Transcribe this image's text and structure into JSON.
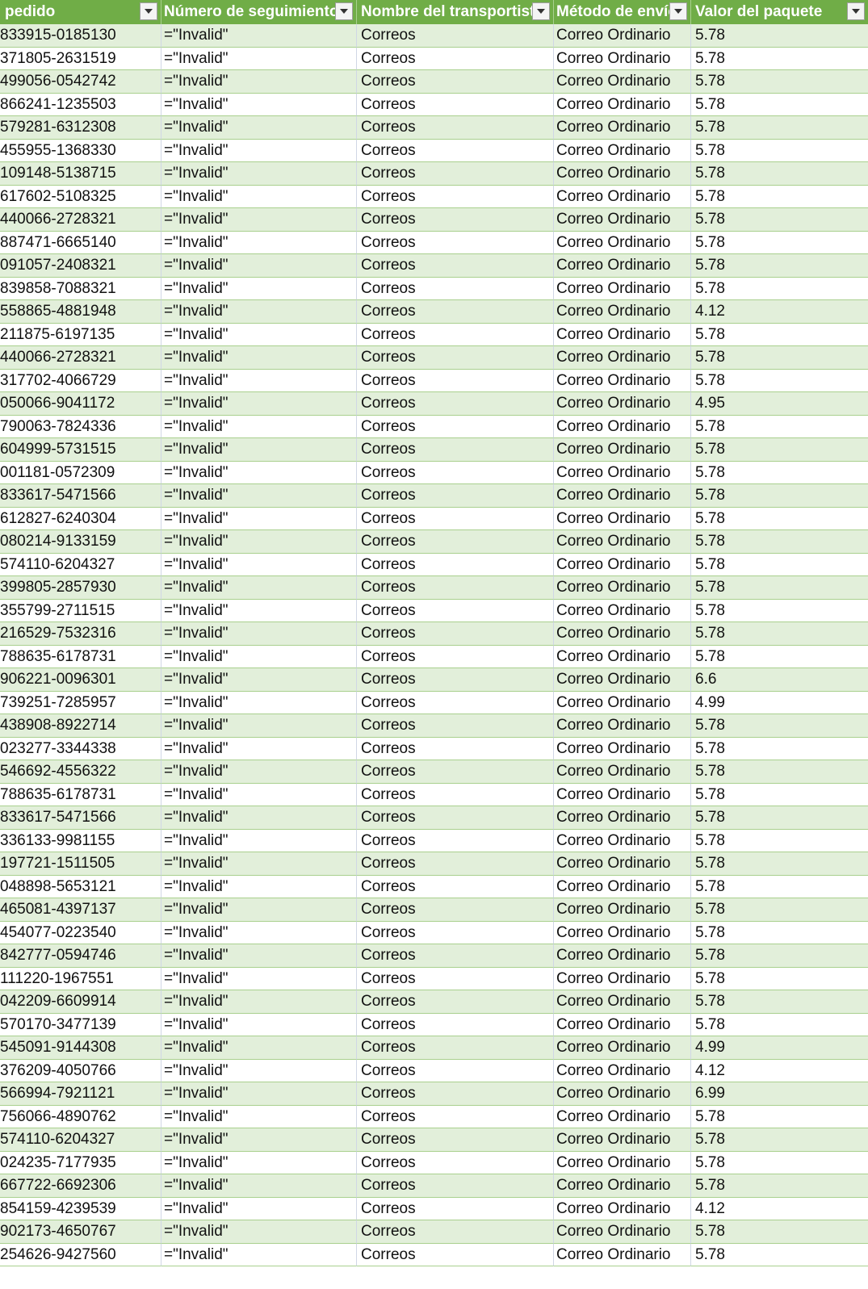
{
  "table": {
    "columns": [
      "pedido",
      "Número de seguimiento",
      "Nombre del transportista",
      "Método de envío",
      "Valor del paquete"
    ],
    "rows": [
      [
        "833915-0185130",
        "=\"Invalid\"",
        "Correos",
        "Correo Ordinario",
        "5.78"
      ],
      [
        "371805-2631519",
        "=\"Invalid\"",
        "Correos",
        "Correo Ordinario",
        "5.78"
      ],
      [
        "499056-0542742",
        "=\"Invalid\"",
        "Correos",
        "Correo Ordinario",
        "5.78"
      ],
      [
        "866241-1235503",
        "=\"Invalid\"",
        "Correos",
        "Correo Ordinario",
        "5.78"
      ],
      [
        "579281-6312308",
        "=\"Invalid\"",
        "Correos",
        "Correo Ordinario",
        "5.78"
      ],
      [
        "455955-1368330",
        "=\"Invalid\"",
        "Correos",
        "Correo Ordinario",
        "5.78"
      ],
      [
        "109148-5138715",
        "=\"Invalid\"",
        "Correos",
        "Correo Ordinario",
        "5.78"
      ],
      [
        "617602-5108325",
        "=\"Invalid\"",
        "Correos",
        "Correo Ordinario",
        "5.78"
      ],
      [
        "440066-2728321",
        "=\"Invalid\"",
        "Correos",
        "Correo Ordinario",
        "5.78"
      ],
      [
        "887471-6665140",
        "=\"Invalid\"",
        "Correos",
        "Correo Ordinario",
        "5.78"
      ],
      [
        "091057-2408321",
        "=\"Invalid\"",
        "Correos",
        "Correo Ordinario",
        "5.78"
      ],
      [
        "839858-7088321",
        "=\"Invalid\"",
        "Correos",
        "Correo Ordinario",
        "5.78"
      ],
      [
        "558865-4881948",
        "=\"Invalid\"",
        "Correos",
        "Correo Ordinario",
        "4.12"
      ],
      [
        "211875-6197135",
        "=\"Invalid\"",
        "Correos",
        "Correo Ordinario",
        "5.78"
      ],
      [
        "440066-2728321",
        "=\"Invalid\"",
        "Correos",
        "Correo Ordinario",
        "5.78"
      ],
      [
        "317702-4066729",
        "=\"Invalid\"",
        "Correos",
        "Correo Ordinario",
        "5.78"
      ],
      [
        "050066-9041172",
        "=\"Invalid\"",
        "Correos",
        "Correo Ordinario",
        "4.95"
      ],
      [
        "790063-7824336",
        "=\"Invalid\"",
        "Correos",
        "Correo Ordinario",
        "5.78"
      ],
      [
        "604999-5731515",
        "=\"Invalid\"",
        "Correos",
        "Correo Ordinario",
        "5.78"
      ],
      [
        "001181-0572309",
        "=\"Invalid\"",
        "Correos",
        "Correo Ordinario",
        "5.78"
      ],
      [
        "833617-5471566",
        "=\"Invalid\"",
        "Correos",
        "Correo Ordinario",
        "5.78"
      ],
      [
        "612827-6240304",
        "=\"Invalid\"",
        "Correos",
        "Correo Ordinario",
        "5.78"
      ],
      [
        "080214-9133159",
        "=\"Invalid\"",
        "Correos",
        "Correo Ordinario",
        "5.78"
      ],
      [
        "574110-6204327",
        "=\"Invalid\"",
        "Correos",
        "Correo Ordinario",
        "5.78"
      ],
      [
        "399805-2857930",
        "=\"Invalid\"",
        "Correos",
        "Correo Ordinario",
        "5.78"
      ],
      [
        "355799-2711515",
        "=\"Invalid\"",
        "Correos",
        "Correo Ordinario",
        "5.78"
      ],
      [
        "216529-7532316",
        "=\"Invalid\"",
        "Correos",
        "Correo Ordinario",
        "5.78"
      ],
      [
        "788635-6178731",
        "=\"Invalid\"",
        "Correos",
        "Correo Ordinario",
        "5.78"
      ],
      [
        "906221-0096301",
        "=\"Invalid\"",
        "Correos",
        "Correo Ordinario",
        "6.6"
      ],
      [
        "739251-7285957",
        "=\"Invalid\"",
        "Correos",
        "Correo Ordinario",
        "4.99"
      ],
      [
        "438908-8922714",
        "=\"Invalid\"",
        "Correos",
        "Correo Ordinario",
        "5.78"
      ],
      [
        "023277-3344338",
        "=\"Invalid\"",
        "Correos",
        "Correo Ordinario",
        "5.78"
      ],
      [
        "546692-4556322",
        "=\"Invalid\"",
        "Correos",
        "Correo Ordinario",
        "5.78"
      ],
      [
        "788635-6178731",
        "=\"Invalid\"",
        "Correos",
        "Correo Ordinario",
        "5.78"
      ],
      [
        "833617-5471566",
        "=\"Invalid\"",
        "Correos",
        "Correo Ordinario",
        "5.78"
      ],
      [
        "336133-9981155",
        "=\"Invalid\"",
        "Correos",
        "Correo Ordinario",
        "5.78"
      ],
      [
        "197721-1511505",
        "=\"Invalid\"",
        "Correos",
        "Correo Ordinario",
        "5.78"
      ],
      [
        "048898-5653121",
        "=\"Invalid\"",
        "Correos",
        "Correo Ordinario",
        "5.78"
      ],
      [
        "465081-4397137",
        "=\"Invalid\"",
        "Correos",
        "Correo Ordinario",
        "5.78"
      ],
      [
        "454077-0223540",
        "=\"Invalid\"",
        "Correos",
        "Correo Ordinario",
        "5.78"
      ],
      [
        "842777-0594746",
        "=\"Invalid\"",
        "Correos",
        "Correo Ordinario",
        "5.78"
      ],
      [
        "111220-1967551",
        "=\"Invalid\"",
        "Correos",
        "Correo Ordinario",
        "5.78"
      ],
      [
        "042209-6609914",
        "=\"Invalid\"",
        "Correos",
        "Correo Ordinario",
        "5.78"
      ],
      [
        "570170-3477139",
        "=\"Invalid\"",
        "Correos",
        "Correo Ordinario",
        "5.78"
      ],
      [
        "545091-9144308",
        "=\"Invalid\"",
        "Correos",
        "Correo Ordinario",
        "4.99"
      ],
      [
        "376209-4050766",
        "=\"Invalid\"",
        "Correos",
        "Correo Ordinario",
        "4.12"
      ],
      [
        "566994-7921121",
        "=\"Invalid\"",
        "Correos",
        "Correo Ordinario",
        "6.99"
      ],
      [
        "756066-4890762",
        "=\"Invalid\"",
        "Correos",
        "Correo Ordinario",
        "5.78"
      ],
      [
        "574110-6204327",
        "=\"Invalid\"",
        "Correos",
        "Correo Ordinario",
        "5.78"
      ],
      [
        "024235-7177935",
        "=\"Invalid\"",
        "Correos",
        "Correo Ordinario",
        "5.78"
      ],
      [
        "667722-6692306",
        "=\"Invalid\"",
        "Correos",
        "Correo Ordinario",
        "5.78"
      ],
      [
        "854159-4239539",
        "=\"Invalid\"",
        "Correos",
        "Correo Ordinario",
        "4.12"
      ],
      [
        "902173-4650767",
        "=\"Invalid\"",
        "Correos",
        "Correo Ordinario",
        "5.78"
      ],
      [
        "254626-9427560",
        "=\"Invalid\"",
        "Correos",
        "Correo Ordinario",
        "5.78"
      ]
    ]
  },
  "colors": {
    "header_bg": "#70ad47",
    "band_row": "#e2efda",
    "plain_row": "#ffffff"
  },
  "icons": {
    "filter": "filter-dropdown-icon"
  }
}
